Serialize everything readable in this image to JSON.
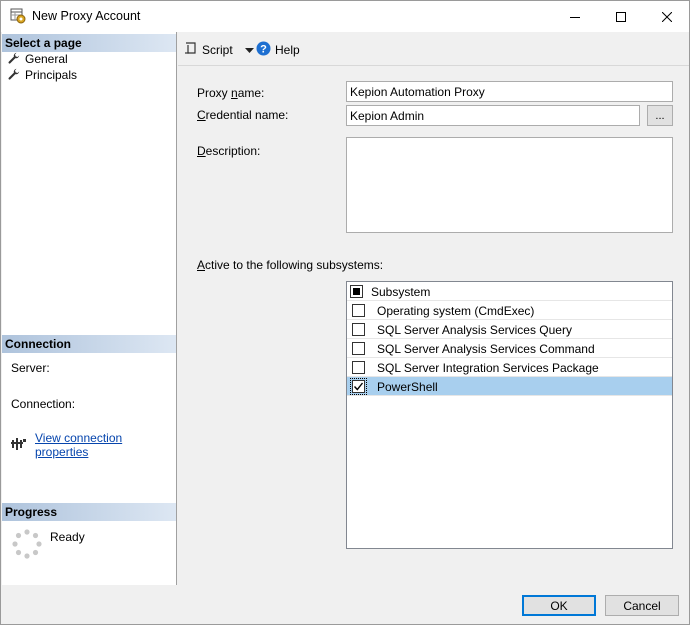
{
  "window": {
    "title": "New Proxy Account"
  },
  "left_pane": {
    "select_page_header": "Select a page",
    "pages": [
      {
        "label": "General",
        "icon": "wrench-icon"
      },
      {
        "label": "Principals",
        "icon": "wrench-icon"
      }
    ],
    "connection_header": "Connection",
    "server_label": "Server:",
    "connection_label": "Connection:",
    "view_connection_link": "View connection properties",
    "progress_header": "Progress",
    "progress_status": "Ready"
  },
  "toolbar": {
    "script_label": "Script",
    "help_label": "Help"
  },
  "form": {
    "proxy_name_label_pre": "Proxy ",
    "proxy_name_label_ak": "n",
    "proxy_name_label_post": "ame:",
    "proxy_name_value": "Kepion Automation Proxy",
    "credential_label_ak": "C",
    "credential_label_post": "redential name:",
    "credential_value": "Kepion Admin",
    "ellipsis_label": "...",
    "description_label_ak": "D",
    "description_label_post": "escription:",
    "description_value": "",
    "subsystems_label_ak": "A",
    "subsystems_label_post": "ctive to the following subsystems:"
  },
  "subsystems": {
    "header": "Subsystem",
    "rows": [
      {
        "label": "Operating system (CmdExec)",
        "checked": false
      },
      {
        "label": "SQL Server Analysis Services Query",
        "checked": false
      },
      {
        "label": "SQL Server Analysis Services Command",
        "checked": false
      },
      {
        "label": "SQL Server Integration Services Package",
        "checked": false
      },
      {
        "label": "PowerShell",
        "checked": true
      }
    ]
  },
  "footer": {
    "ok_label": "OK",
    "cancel_label": "Cancel"
  },
  "colors": {
    "selection": "#a8cfee",
    "section_header": "#aec3dc",
    "link": "#0645ad",
    "default_button_border": "#0078d7"
  }
}
